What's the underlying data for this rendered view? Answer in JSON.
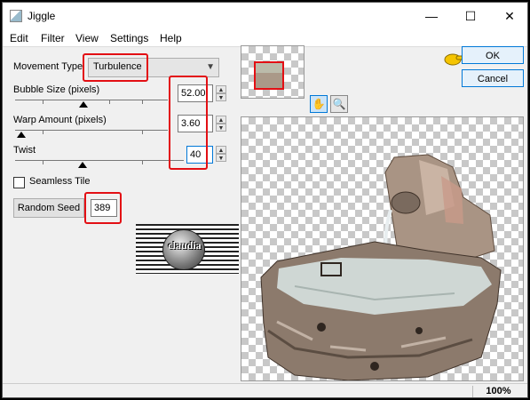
{
  "window": {
    "title": "Jiggle",
    "minimize_glyph": "—",
    "maximize_glyph": "☐",
    "close_glyph": "✕"
  },
  "menu": [
    "Edit",
    "Filter",
    "View",
    "Settings",
    "Help"
  ],
  "movement": {
    "label": "Movement Type",
    "value": "Turbulence"
  },
  "bubble": {
    "label": "Bubble Size (pixels)",
    "value": "52.00",
    "slider_fraction": 0.45
  },
  "warp": {
    "label": "Warp Amount (pixels)",
    "value": "3.60",
    "slider_fraction": 0.04
  },
  "twist": {
    "label": "Twist",
    "value": "40",
    "slider_fraction": 0.4
  },
  "seamless": {
    "label": "Seamless Tile",
    "checked": false
  },
  "random_seed": {
    "label": "Random Seed",
    "value": "389"
  },
  "watermark": {
    "text": "claudia"
  },
  "buttons": {
    "ok": "OK",
    "cancel": "Cancel"
  },
  "tools": [
    "hand-icon",
    "zoom-icon"
  ],
  "status": {
    "zoom": "100%"
  },
  "colors": {
    "highlight_red": "#e30f14",
    "accent_blue": "#0078d7"
  }
}
